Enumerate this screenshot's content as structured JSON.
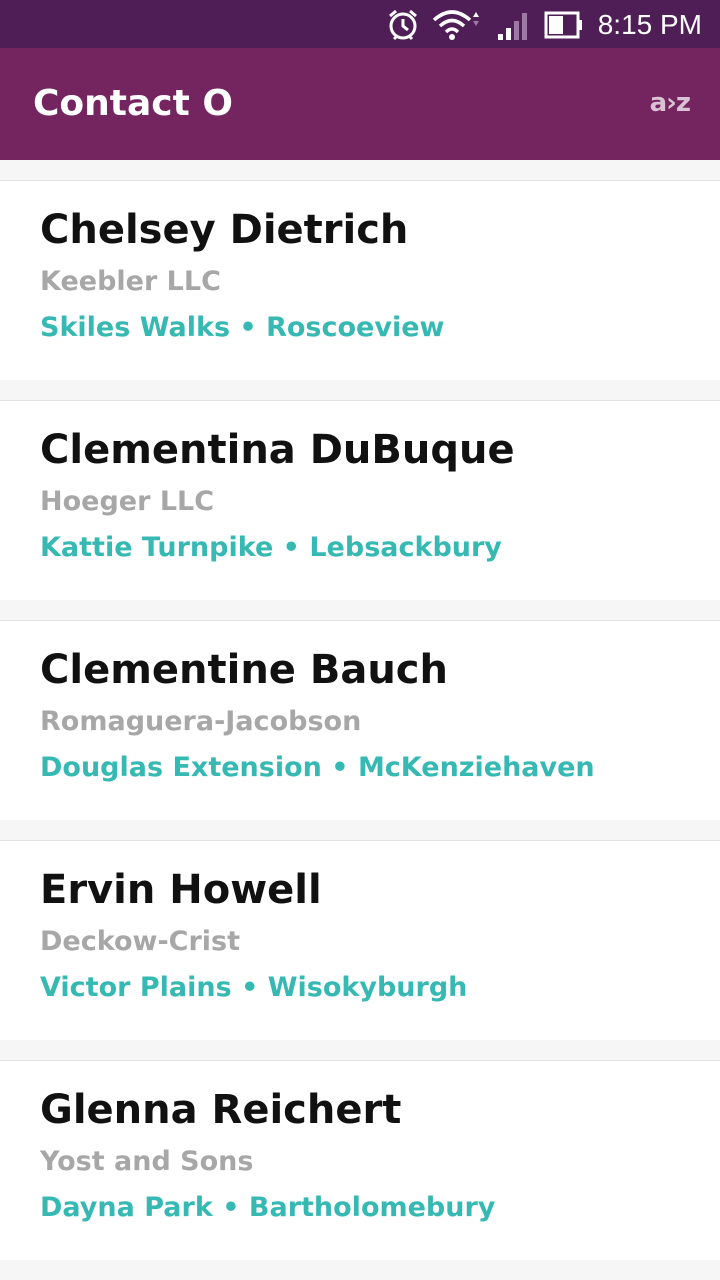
{
  "status_bar": {
    "time": "8:15 PM",
    "icons": [
      "alarm-icon",
      "wifi-icon",
      "cell-signal-icon",
      "battery-icon"
    ]
  },
  "app_bar": {
    "title": "Contact O",
    "sort_label": "a›z"
  },
  "contacts": [
    {
      "name": "Chelsey Dietrich",
      "company": "Keebler LLC",
      "street": "Skiles Walks",
      "separator": "•",
      "city": "Roscoeview"
    },
    {
      "name": "Clementina DuBuque",
      "company": "Hoeger LLC",
      "street": "Kattie Turnpike",
      "separator": "•",
      "city": "Lebsackbury"
    },
    {
      "name": "Clementine Bauch",
      "company": "Romaguera-Jacobson",
      "street": "Douglas Extension",
      "separator": "•",
      "city": "McKenziehaven"
    },
    {
      "name": "Ervin Howell",
      "company": "Deckow-Crist",
      "street": "Victor Plains",
      "separator": "•",
      "city": "Wisokyburgh"
    },
    {
      "name": "Glenna Reichert",
      "company": "Yost and Sons",
      "street": "Dayna Park",
      "separator": "•",
      "city": "Bartholomebury"
    }
  ],
  "colors": {
    "status_bar": "#4f1e57",
    "app_bar": "#74245f",
    "accent": "#36b8b3",
    "secondary_text": "#a7a7a7"
  }
}
